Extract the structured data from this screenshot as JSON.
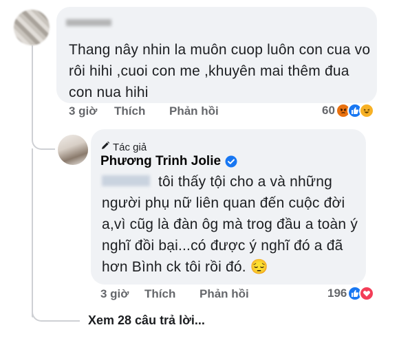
{
  "comment": {
    "text": "Thang nây nhin la muôn cuop luôn con cua vo rôi hihi ,cuoi con me ,khuyên mai thêm đua con nua hihi",
    "time": "3 giờ",
    "like_label": "Thích",
    "reply_label": "Phản hồi",
    "reaction_count": "60",
    "reaction_icons": [
      "angry-icon",
      "like-icon",
      "haha-icon"
    ]
  },
  "reply": {
    "badge_label": "Tác giả",
    "author_name": "Phương Trinh Jolie",
    "text": "tôi thấy tội cho a và những người phụ nữ liên quan đến cuộc đời a,vì cũg là đàn ôg mà trog đầu a toàn ý nghĩ đồi bại...có được ý nghĩ đó a đã hơn Bình ck tôi rồi đó. 😔",
    "time": "3 giờ",
    "like_label": "Thích",
    "reply_label": "Phản hồi",
    "reaction_count": "196",
    "reaction_icons": [
      "like-icon",
      "love-icon"
    ]
  },
  "see_more_label": "Xem 28 câu trả lời..."
}
